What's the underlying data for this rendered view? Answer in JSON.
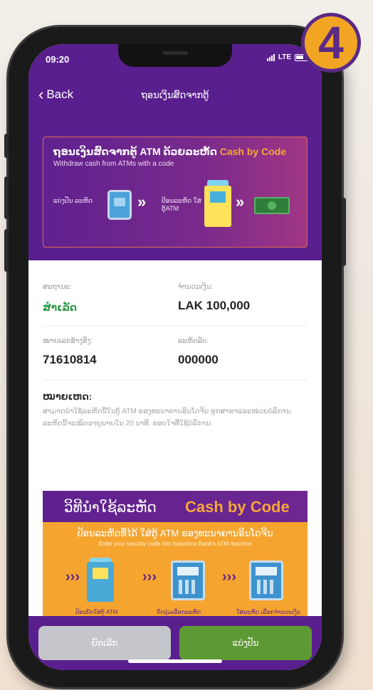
{
  "step_number": "4",
  "status_bar": {
    "time": "09:20",
    "network": "LTE"
  },
  "nav": {
    "back_label": "Back",
    "title": "ຖອນເງິນສົດຈາກຕູ້"
  },
  "banner": {
    "title_lao": "ຖອນເງິນສົດຈາກຕູ້ ATM ດ້ວຍລະຫັດ",
    "title_brand": "Cash by Code",
    "subtitle": "Withdraw cash from ATMs with a code",
    "step1": "ແບ່ງປັນ ລະຫັດ",
    "step2": "ປ້ອນລະຫັດ ໃສ່ຕູ້ATM"
  },
  "details": {
    "status_label": "ສະຖານະ:",
    "status_value": "ສຳເລັດ",
    "amount_label": "ຈຳນວນເງິນ:",
    "amount_value": "LAK 100,000",
    "reference_label": "ໝາຍເລກອ້າງອີງ:",
    "reference_value": "71610814",
    "code_label": "ລະຫັດລັບ:",
    "code_value": "000000",
    "note_title": "ໝາຍເຫດ:",
    "note_text": "ສາມາດນຳໃຊ້ລະຫັດນີ້ໃນຕູ້ ATM ຂອງທະນາຄານອິນໂດຈີນ ທຸກສາຂາແລະໜ່ວຍບໍລິການ. ລະຫັດນີ້ຈະໝົດອາຍຸພາຍໃນ 20 ນາທີ. ຂອບໃຈທີ່ໃຊ້ບໍລິການ."
  },
  "guide": {
    "heading_lao": "ວິທີນຳໃຊ້ລະຫັດ",
    "heading_brand": "Cash by Code",
    "line1": "ປ້ອນລະຫັດທີ່ໄດ້ ໃສ່ຕູ້ ATM ຂອງທະນາຄານອິນໂດຈີນ",
    "line2": "Enter your security code into Indochina Bank's ATM machine",
    "caption1": "ປ້ອນບັດໃສ່ຕູ້ ATM",
    "caption2": "ກົດປຸ່ມເລືອກລະຫັດ",
    "caption3": "ໃສ່ລະຫັດ ເລືອກຈຳນວນເງິນ"
  },
  "buttons": {
    "cancel": "ຍົກເລີກ",
    "share": "ແບ່ງປັນ"
  },
  "colors": {
    "brand_purple": "#5a1f8e",
    "accent_orange": "#f5a52f",
    "success_green": "#2e9b4a",
    "share_green": "#5e9a34"
  }
}
